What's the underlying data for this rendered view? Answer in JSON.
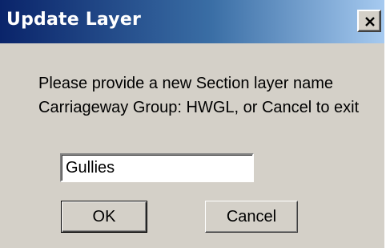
{
  "window": {
    "title": "Update Layer",
    "close_icon": "close-icon"
  },
  "message": {
    "line1": "Please provide a new Section layer name",
    "line2": "Carriageway Group: HWGL, or Cancel to exit"
  },
  "layer_name_input": {
    "value": "Gullies"
  },
  "buttons": {
    "ok_label": "OK",
    "cancel_label": "Cancel"
  },
  "colors": {
    "titlebar_start": "#0a246a",
    "titlebar_end": "#a6caf0",
    "dialog_face": "#d4d0c8"
  }
}
